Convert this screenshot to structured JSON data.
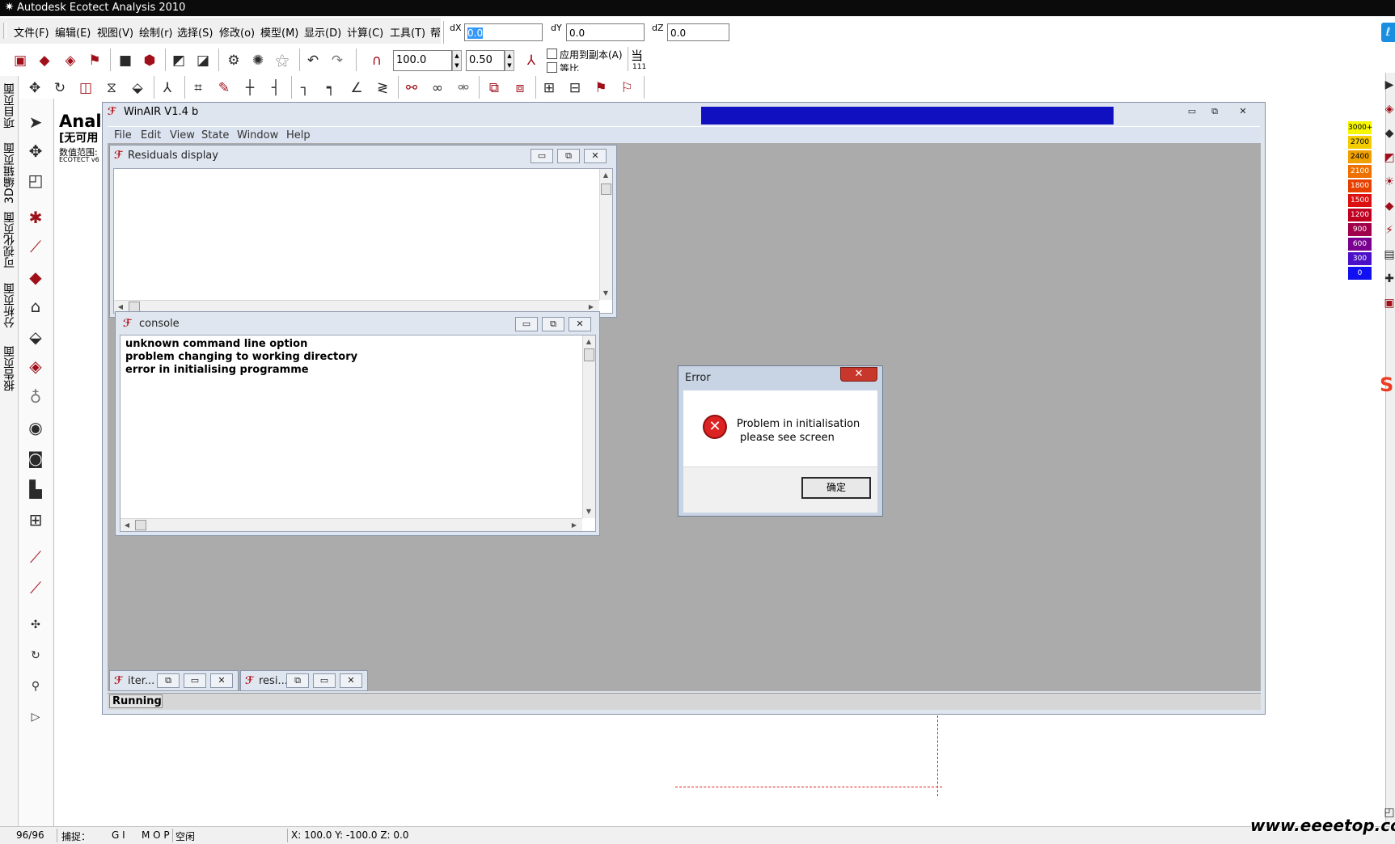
{
  "host": {
    "title": "Autodesk Ecotect Analysis 2010",
    "menu": [
      "文件(F)",
      "编辑(E)",
      "视图(V)",
      "绘制(r)",
      "选择(S)",
      "修改(o)",
      "模型(M)",
      "显示(D)",
      "计算(C)",
      "工具(T)",
      "帮"
    ],
    "coords": {
      "dx_label": "dX",
      "dx_value": "0.0",
      "dy_label": "dY",
      "dy_value": "0.0",
      "dz_label": "dZ",
      "dz_value": "0.0"
    },
    "spin1": "100.0",
    "spin2": "0.50",
    "checkbox1_label": "应用到副本(A)",
    "checkbox2_label": "等比",
    "right_char_top": "当",
    "right_char_bottom": "111",
    "left_tabs": [
      "项目页面",
      "3D编辑页面",
      "可视化页面",
      "分析页面",
      "报告页面"
    ],
    "canvas": {
      "line1": "Analy",
      "line2": "[无可用",
      "line3": "数值范围:",
      "line4": "ECOTECT v6"
    },
    "legend": [
      {
        "label": "3000+",
        "color": "#f6f600",
        "text_color": "#000000"
      },
      {
        "label": "2700",
        "color": "#f5cc00",
        "text_color": "#000000"
      },
      {
        "label": "2400",
        "color": "#f0a000",
        "text_color": "#000000"
      },
      {
        "label": "2100",
        "color": "#ee7000",
        "text_color": "#ffffff"
      },
      {
        "label": "1800",
        "color": "#e64000",
        "text_color": "#ffffff"
      },
      {
        "label": "1500",
        "color": "#dc1010",
        "text_color": "#ffffff"
      },
      {
        "label": "1200",
        "color": "#c00020",
        "text_color": "#ffffff"
      },
      {
        "label": "900",
        "color": "#a0004a",
        "text_color": "#ffffff"
      },
      {
        "label": "600",
        "color": "#7a0090",
        "text_color": "#ffffff"
      },
      {
        "label": "300",
        "color": "#4a10c8",
        "text_color": "#ffffff"
      },
      {
        "label": "0",
        "color": "#1010f0",
        "text_color": "#ffffff"
      }
    ],
    "status": {
      "page": "96/96",
      "snap_label": "捕捉：",
      "snap1": "G I",
      "snap2": "M O P",
      "state": "空闲",
      "coords": "X: 100.0   Y: -100.0   Z: 0.0"
    },
    "watermark": "www.eeeetop.com"
  },
  "winair": {
    "title": "WinAIR V1.4 b",
    "menu": [
      "File",
      "Edit",
      "View",
      "State",
      "Window",
      "Help"
    ],
    "residuals_title": "Residuals display",
    "console_title": "console",
    "console_lines": [
      " unknown command line option",
      "problem changing to working directory",
      " error in initialising programme"
    ],
    "minimized": [
      "iter...",
      "resi..."
    ],
    "status": "Running"
  },
  "error_dialog": {
    "title": "Error",
    "message_line1": "Problem in initialisation",
    "message_line2": "please see screen",
    "ok_label": "确定"
  },
  "colors": {
    "title_bar": "#0b0b0b",
    "winair_banner": "#1010c0",
    "mdi_background": "#ababab",
    "close_button": "#c8372b"
  }
}
